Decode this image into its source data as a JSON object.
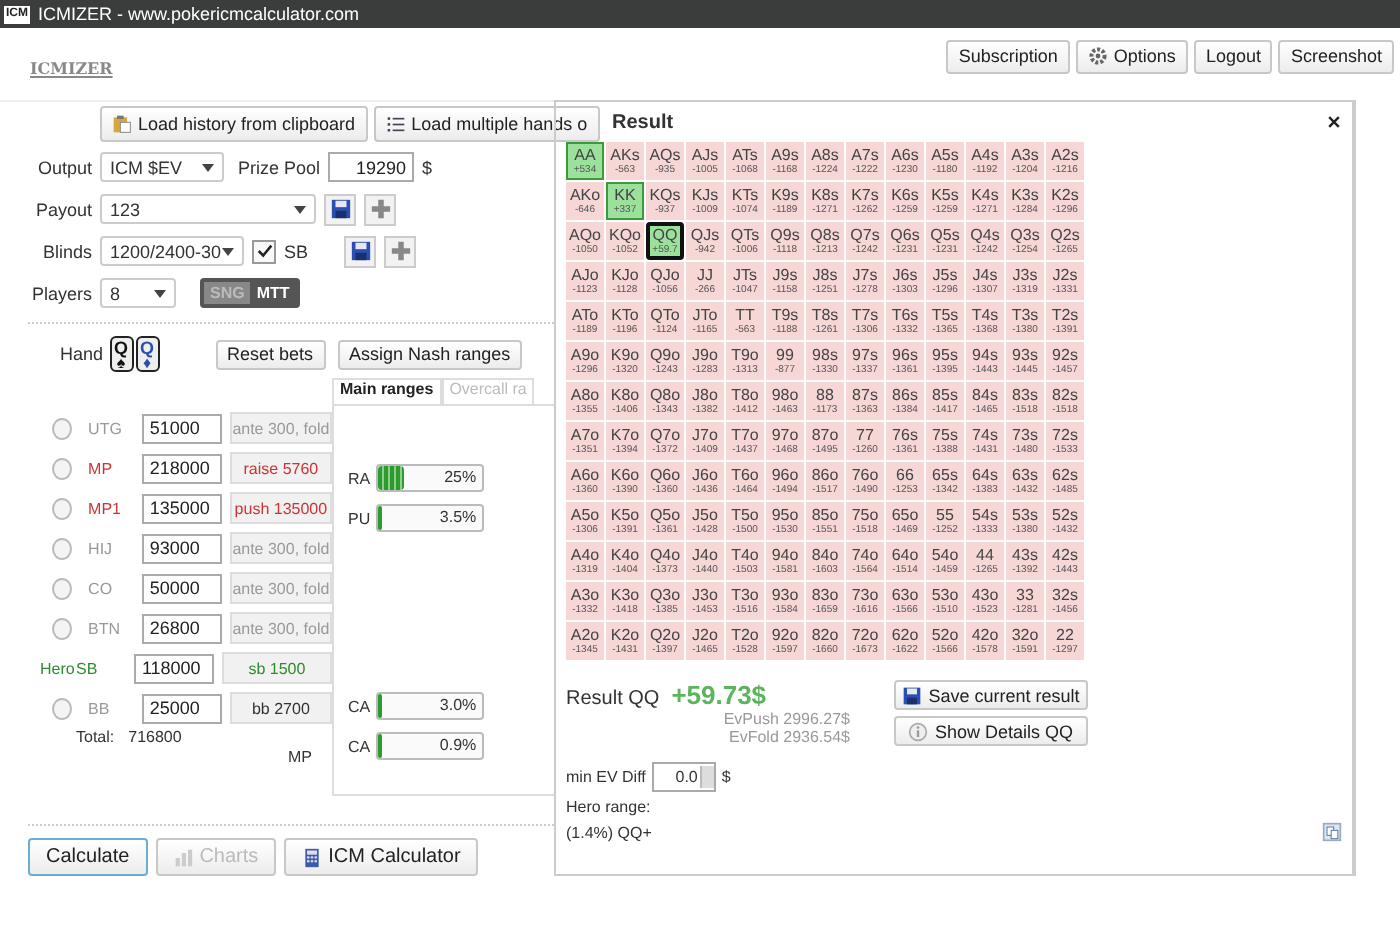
{
  "window": {
    "title": "ICMIZER - www.pokericmcalculator.com",
    "icon": "ICM"
  },
  "header": {
    "logo": "ICMIZER",
    "buttons": [
      "Subscription",
      "Options",
      "Logout",
      "Screenshot"
    ]
  },
  "load_buttons": [
    "Load history from clipboard",
    "Load multiple hands o"
  ],
  "settings": {
    "output": {
      "label": "Output",
      "value": "ICM $EV"
    },
    "prize_pool": {
      "label": "Prize Pool",
      "value": "19290",
      "unit": "$"
    },
    "payout": {
      "label": "Payout",
      "value": "123"
    },
    "blinds": {
      "label": "Blinds",
      "value": "1200/2400-30",
      "sb_label": "SB",
      "sb_checked": true
    },
    "players": {
      "label": "Players",
      "value": "8"
    },
    "mode": [
      {
        "label": "SNG",
        "selected": false
      },
      {
        "label": "MTT",
        "selected": true
      }
    ]
  },
  "hand": {
    "label": "Hand",
    "cards": [
      {
        "rank": "Q",
        "suit": "♠",
        "color": "#111111"
      },
      {
        "rank": "Q",
        "suit": "♦",
        "color": "#2a4fb0"
      }
    ]
  },
  "actions": [
    "Reset bets",
    "Assign Nash ranges"
  ],
  "positions": [
    {
      "name": "UTG",
      "stack": "51000",
      "action": "ante 300, fold",
      "kind": "fold",
      "selected": false
    },
    {
      "name": "MP",
      "stack": "218000",
      "action": "raise 5760",
      "kind": "raise",
      "selected": false
    },
    {
      "name": "MP1",
      "stack": "135000",
      "action": "push 135000",
      "kind": "raise",
      "selected": false
    },
    {
      "name": "HIJ",
      "stack": "93000",
      "action": "ante 300, fold",
      "kind": "fold",
      "selected": false
    },
    {
      "name": "CO",
      "stack": "50000",
      "action": "ante 300, fold",
      "kind": "fold",
      "selected": false
    },
    {
      "name": "BTN",
      "stack": "26800",
      "action": "ante 300, fold",
      "kind": "fold",
      "selected": false
    },
    {
      "name": "SB",
      "hero_label": "Hero",
      "stack": "118000",
      "action": "sb 1500",
      "kind": "hero"
    },
    {
      "name": "BB",
      "stack": "25000",
      "action": "bb 2700",
      "kind": "blind",
      "selected": false
    }
  ],
  "total": {
    "label": "Total:",
    "value": "716800"
  },
  "ranges": {
    "tabs": [
      {
        "label": "Main ranges",
        "selected": true
      },
      {
        "label": "Overcall ra",
        "selected": false
      }
    ],
    "upper_bars": [
      {
        "label": "RA",
        "reading": "25%",
        "level": 0.25
      },
      {
        "label": "PU",
        "reading": "3.5%",
        "level": 0.035
      }
    ],
    "lower_bars": [
      {
        "label": "CA",
        "reading": "3.0%",
        "level": 0.03
      },
      {
        "label": "CA",
        "reading": "0.9%",
        "level": 0.009
      }
    ],
    "caller": "MP"
  },
  "bottom_buttons": [
    {
      "label": "Calculate",
      "disabled": false
    },
    {
      "label": "Charts",
      "disabled": true
    },
    {
      "label": "ICM Calculator",
      "disabled": false
    }
  ],
  "result": {
    "title": "Result",
    "grid": [
      [
        {
          "h": "AA",
          "ev": "+534",
          "in_range": true,
          "selected": false
        },
        {
          "h": "AKs",
          "ev": "-563",
          "in_range": false,
          "selected": false
        },
        {
          "h": "AQs",
          "ev": "-935",
          "in_range": false,
          "selected": false
        },
        {
          "h": "AJs",
          "ev": "-1005",
          "in_range": false,
          "selected": false
        },
        {
          "h": "ATs",
          "ev": "-1068",
          "in_range": false,
          "selected": false
        },
        {
          "h": "A9s",
          "ev": "-1168",
          "in_range": false,
          "selected": false
        },
        {
          "h": "A8s",
          "ev": "-1224",
          "in_range": false,
          "selected": false
        },
        {
          "h": "A7s",
          "ev": "-1222",
          "in_range": false,
          "selected": false
        },
        {
          "h": "A6s",
          "ev": "-1230",
          "in_range": false,
          "selected": false
        },
        {
          "h": "A5s",
          "ev": "-1180",
          "in_range": false,
          "selected": false
        },
        {
          "h": "A4s",
          "ev": "-1192",
          "in_range": false,
          "selected": false
        },
        {
          "h": "A3s",
          "ev": "-1204",
          "in_range": false,
          "selected": false
        },
        {
          "h": "A2s",
          "ev": "-1216",
          "in_range": false,
          "selected": false
        }
      ],
      [
        {
          "h": "AKo",
          "ev": "-646",
          "in_range": false,
          "selected": false
        },
        {
          "h": "KK",
          "ev": "+337",
          "in_range": true,
          "selected": false
        },
        {
          "h": "KQs",
          "ev": "-937",
          "in_range": false,
          "selected": false
        },
        {
          "h": "KJs",
          "ev": "-1009",
          "in_range": false,
          "selected": false
        },
        {
          "h": "KTs",
          "ev": "-1074",
          "in_range": false,
          "selected": false
        },
        {
          "h": "K9s",
          "ev": "-1189",
          "in_range": false,
          "selected": false
        },
        {
          "h": "K8s",
          "ev": "-1271",
          "in_range": false,
          "selected": false
        },
        {
          "h": "K7s",
          "ev": "-1262",
          "in_range": false,
          "selected": false
        },
        {
          "h": "K6s",
          "ev": "-1259",
          "in_range": false,
          "selected": false
        },
        {
          "h": "K5s",
          "ev": "-1259",
          "in_range": false,
          "selected": false
        },
        {
          "h": "K4s",
          "ev": "-1271",
          "in_range": false,
          "selected": false
        },
        {
          "h": "K3s",
          "ev": "-1284",
          "in_range": false,
          "selected": false
        },
        {
          "h": "K2s",
          "ev": "-1296",
          "in_range": false,
          "selected": false
        }
      ],
      [
        {
          "h": "AQo",
          "ev": "-1050",
          "in_range": false,
          "selected": false
        },
        {
          "h": "KQo",
          "ev": "-1052",
          "in_range": false,
          "selected": false
        },
        {
          "h": "QQ",
          "ev": "+59.7",
          "in_range": true,
          "selected": true
        },
        {
          "h": "QJs",
          "ev": "-942",
          "in_range": false,
          "selected": false
        },
        {
          "h": "QTs",
          "ev": "-1006",
          "in_range": false,
          "selected": false
        },
        {
          "h": "Q9s",
          "ev": "-1118",
          "in_range": false,
          "selected": false
        },
        {
          "h": "Q8s",
          "ev": "-1213",
          "in_range": false,
          "selected": false
        },
        {
          "h": "Q7s",
          "ev": "-1242",
          "in_range": false,
          "selected": false
        },
        {
          "h": "Q6s",
          "ev": "-1231",
          "in_range": false,
          "selected": false
        },
        {
          "h": "Q5s",
          "ev": "-1231",
          "in_range": false,
          "selected": false
        },
        {
          "h": "Q4s",
          "ev": "-1242",
          "in_range": false,
          "selected": false
        },
        {
          "h": "Q3s",
          "ev": "-1254",
          "in_range": false,
          "selected": false
        },
        {
          "h": "Q2s",
          "ev": "-1265",
          "in_range": false,
          "selected": false
        }
      ],
      [
        {
          "h": "AJo",
          "ev": "-1123",
          "in_range": false,
          "selected": false
        },
        {
          "h": "KJo",
          "ev": "-1128",
          "in_range": false,
          "selected": false
        },
        {
          "h": "QJo",
          "ev": "-1056",
          "in_range": false,
          "selected": false
        },
        {
          "h": "JJ",
          "ev": "-266",
          "in_range": false,
          "selected": false
        },
        {
          "h": "JTs",
          "ev": "-1047",
          "in_range": false,
          "selected": false
        },
        {
          "h": "J9s",
          "ev": "-1158",
          "in_range": false,
          "selected": false
        },
        {
          "h": "J8s",
          "ev": "-1251",
          "in_range": false,
          "selected": false
        },
        {
          "h": "J7s",
          "ev": "-1278",
          "in_range": false,
          "selected": false
        },
        {
          "h": "J6s",
          "ev": "-1303",
          "in_range": false,
          "selected": false
        },
        {
          "h": "J5s",
          "ev": "-1296",
          "in_range": false,
          "selected": false
        },
        {
          "h": "J4s",
          "ev": "-1307",
          "in_range": false,
          "selected": false
        },
        {
          "h": "J3s",
          "ev": "-1319",
          "in_range": false,
          "selected": false
        },
        {
          "h": "J2s",
          "ev": "-1331",
          "in_range": false,
          "selected": false
        }
      ],
      [
        {
          "h": "ATo",
          "ev": "-1189",
          "in_range": false,
          "selected": false
        },
        {
          "h": "KTo",
          "ev": "-1196",
          "in_range": false,
          "selected": false
        },
        {
          "h": "QTo",
          "ev": "-1124",
          "in_range": false,
          "selected": false
        },
        {
          "h": "JTo",
          "ev": "-1165",
          "in_range": false,
          "selected": false
        },
        {
          "h": "TT",
          "ev": "-563",
          "in_range": false,
          "selected": false
        },
        {
          "h": "T9s",
          "ev": "-1188",
          "in_range": false,
          "selected": false
        },
        {
          "h": "T8s",
          "ev": "-1261",
          "in_range": false,
          "selected": false
        },
        {
          "h": "T7s",
          "ev": "-1306",
          "in_range": false,
          "selected": false
        },
        {
          "h": "T6s",
          "ev": "-1332",
          "in_range": false,
          "selected": false
        },
        {
          "h": "T5s",
          "ev": "-1365",
          "in_range": false,
          "selected": false
        },
        {
          "h": "T4s",
          "ev": "-1368",
          "in_range": false,
          "selected": false
        },
        {
          "h": "T3s",
          "ev": "-1380",
          "in_range": false,
          "selected": false
        },
        {
          "h": "T2s",
          "ev": "-1391",
          "in_range": false,
          "selected": false
        }
      ],
      [
        {
          "h": "A9o",
          "ev": "-1296",
          "in_range": false,
          "selected": false
        },
        {
          "h": "K9o",
          "ev": "-1320",
          "in_range": false,
          "selected": false
        },
        {
          "h": "Q9o",
          "ev": "-1243",
          "in_range": false,
          "selected": false
        },
        {
          "h": "J9o",
          "ev": "-1283",
          "in_range": false,
          "selected": false
        },
        {
          "h": "T9o",
          "ev": "-1313",
          "in_range": false,
          "selected": false
        },
        {
          "h": "99",
          "ev": "-877",
          "in_range": false,
          "selected": false
        },
        {
          "h": "98s",
          "ev": "-1330",
          "in_range": false,
          "selected": false
        },
        {
          "h": "97s",
          "ev": "-1337",
          "in_range": false,
          "selected": false
        },
        {
          "h": "96s",
          "ev": "-1361",
          "in_range": false,
          "selected": false
        },
        {
          "h": "95s",
          "ev": "-1395",
          "in_range": false,
          "selected": false
        },
        {
          "h": "94s",
          "ev": "-1443",
          "in_range": false,
          "selected": false
        },
        {
          "h": "93s",
          "ev": "-1445",
          "in_range": false,
          "selected": false
        },
        {
          "h": "92s",
          "ev": "-1457",
          "in_range": false,
          "selected": false
        }
      ],
      [
        {
          "h": "A8o",
          "ev": "-1355",
          "in_range": false,
          "selected": false
        },
        {
          "h": "K8o",
          "ev": "-1406",
          "in_range": false,
          "selected": false
        },
        {
          "h": "Q8o",
          "ev": "-1343",
          "in_range": false,
          "selected": false
        },
        {
          "h": "J8o",
          "ev": "-1382",
          "in_range": false,
          "selected": false
        },
        {
          "h": "T8o",
          "ev": "-1412",
          "in_range": false,
          "selected": false
        },
        {
          "h": "98o",
          "ev": "-1463",
          "in_range": false,
          "selected": false
        },
        {
          "h": "88",
          "ev": "-1173",
          "in_range": false,
          "selected": false
        },
        {
          "h": "87s",
          "ev": "-1363",
          "in_range": false,
          "selected": false
        },
        {
          "h": "86s",
          "ev": "-1384",
          "in_range": false,
          "selected": false
        },
        {
          "h": "85s",
          "ev": "-1417",
          "in_range": false,
          "selected": false
        },
        {
          "h": "84s",
          "ev": "-1465",
          "in_range": false,
          "selected": false
        },
        {
          "h": "83s",
          "ev": "-1518",
          "in_range": false,
          "selected": false
        },
        {
          "h": "82s",
          "ev": "-1518",
          "in_range": false,
          "selected": false
        }
      ],
      [
        {
          "h": "A7o",
          "ev": "-1351",
          "in_range": false,
          "selected": false
        },
        {
          "h": "K7o",
          "ev": "-1394",
          "in_range": false,
          "selected": false
        },
        {
          "h": "Q7o",
          "ev": "-1372",
          "in_range": false,
          "selected": false
        },
        {
          "h": "J7o",
          "ev": "-1409",
          "in_range": false,
          "selected": false
        },
        {
          "h": "T7o",
          "ev": "-1437",
          "in_range": false,
          "selected": false
        },
        {
          "h": "97o",
          "ev": "-1468",
          "in_range": false,
          "selected": false
        },
        {
          "h": "87o",
          "ev": "-1495",
          "in_range": false,
          "selected": false
        },
        {
          "h": "77",
          "ev": "-1260",
          "in_range": false,
          "selected": false
        },
        {
          "h": "76s",
          "ev": "-1361",
          "in_range": false,
          "selected": false
        },
        {
          "h": "75s",
          "ev": "-1388",
          "in_range": false,
          "selected": false
        },
        {
          "h": "74s",
          "ev": "-1431",
          "in_range": false,
          "selected": false
        },
        {
          "h": "73s",
          "ev": "-1480",
          "in_range": false,
          "selected": false
        },
        {
          "h": "72s",
          "ev": "-1533",
          "in_range": false,
          "selected": false
        }
      ],
      [
        {
          "h": "A6o",
          "ev": "-1360",
          "in_range": false,
          "selected": false
        },
        {
          "h": "K6o",
          "ev": "-1390",
          "in_range": false,
          "selected": false
        },
        {
          "h": "Q6o",
          "ev": "-1360",
          "in_range": false,
          "selected": false
        },
        {
          "h": "J6o",
          "ev": "-1436",
          "in_range": false,
          "selected": false
        },
        {
          "h": "T6o",
          "ev": "-1464",
          "in_range": false,
          "selected": false
        },
        {
          "h": "96o",
          "ev": "-1494",
          "in_range": false,
          "selected": false
        },
        {
          "h": "86o",
          "ev": "-1517",
          "in_range": false,
          "selected": false
        },
        {
          "h": "76o",
          "ev": "-1490",
          "in_range": false,
          "selected": false
        },
        {
          "h": "66",
          "ev": "-1253",
          "in_range": false,
          "selected": false
        },
        {
          "h": "65s",
          "ev": "-1342",
          "in_range": false,
          "selected": false
        },
        {
          "h": "64s",
          "ev": "-1383",
          "in_range": false,
          "selected": false
        },
        {
          "h": "63s",
          "ev": "-1432",
          "in_range": false,
          "selected": false
        },
        {
          "h": "62s",
          "ev": "-1485",
          "in_range": false,
          "selected": false
        }
      ],
      [
        {
          "h": "A5o",
          "ev": "-1306",
          "in_range": false,
          "selected": false
        },
        {
          "h": "K5o",
          "ev": "-1391",
          "in_range": false,
          "selected": false
        },
        {
          "h": "Q5o",
          "ev": "-1361",
          "in_range": false,
          "selected": false
        },
        {
          "h": "J5o",
          "ev": "-1428",
          "in_range": false,
          "selected": false
        },
        {
          "h": "T5o",
          "ev": "-1500",
          "in_range": false,
          "selected": false
        },
        {
          "h": "95o",
          "ev": "-1530",
          "in_range": false,
          "selected": false
        },
        {
          "h": "85o",
          "ev": "-1551",
          "in_range": false,
          "selected": false
        },
        {
          "h": "75o",
          "ev": "-1518",
          "in_range": false,
          "selected": false
        },
        {
          "h": "65o",
          "ev": "-1469",
          "in_range": false,
          "selected": false
        },
        {
          "h": "55",
          "ev": "-1252",
          "in_range": false,
          "selected": false
        },
        {
          "h": "54s",
          "ev": "-1333",
          "in_range": false,
          "selected": false
        },
        {
          "h": "53s",
          "ev": "-1380",
          "in_range": false,
          "selected": false
        },
        {
          "h": "52s",
          "ev": "-1432",
          "in_range": false,
          "selected": false
        }
      ],
      [
        {
          "h": "A4o",
          "ev": "-1319",
          "in_range": false,
          "selected": false
        },
        {
          "h": "K4o",
          "ev": "-1404",
          "in_range": false,
          "selected": false
        },
        {
          "h": "Q4o",
          "ev": "-1373",
          "in_range": false,
          "selected": false
        },
        {
          "h": "J4o",
          "ev": "-1440",
          "in_range": false,
          "selected": false
        },
        {
          "h": "T4o",
          "ev": "-1503",
          "in_range": false,
          "selected": false
        },
        {
          "h": "94o",
          "ev": "-1581",
          "in_range": false,
          "selected": false
        },
        {
          "h": "84o",
          "ev": "-1603",
          "in_range": false,
          "selected": false
        },
        {
          "h": "74o",
          "ev": "-1564",
          "in_range": false,
          "selected": false
        },
        {
          "h": "64o",
          "ev": "-1514",
          "in_range": false,
          "selected": false
        },
        {
          "h": "54o",
          "ev": "-1459",
          "in_range": false,
          "selected": false
        },
        {
          "h": "44",
          "ev": "-1265",
          "in_range": false,
          "selected": false
        },
        {
          "h": "43s",
          "ev": "-1392",
          "in_range": false,
          "selected": false
        },
        {
          "h": "42s",
          "ev": "-1443",
          "in_range": false,
          "selected": false
        }
      ],
      [
        {
          "h": "A3o",
          "ev": "-1332",
          "in_range": false,
          "selected": false
        },
        {
          "h": "K3o",
          "ev": "-1418",
          "in_range": false,
          "selected": false
        },
        {
          "h": "Q3o",
          "ev": "-1385",
          "in_range": false,
          "selected": false
        },
        {
          "h": "J3o",
          "ev": "-1453",
          "in_range": false,
          "selected": false
        },
        {
          "h": "T3o",
          "ev": "-1516",
          "in_range": false,
          "selected": false
        },
        {
          "h": "93o",
          "ev": "-1584",
          "in_range": false,
          "selected": false
        },
        {
          "h": "83o",
          "ev": "-1659",
          "in_range": false,
          "selected": false
        },
        {
          "h": "73o",
          "ev": "-1616",
          "in_range": false,
          "selected": false
        },
        {
          "h": "63o",
          "ev": "-1566",
          "in_range": false,
          "selected": false
        },
        {
          "h": "53o",
          "ev": "-1510",
          "in_range": false,
          "selected": false
        },
        {
          "h": "43o",
          "ev": "-1523",
          "in_range": false,
          "selected": false
        },
        {
          "h": "33",
          "ev": "-1281",
          "in_range": false,
          "selected": false
        },
        {
          "h": "32s",
          "ev": "-1456",
          "in_range": false,
          "selected": false
        }
      ],
      [
        {
          "h": "A2o",
          "ev": "-1345",
          "in_range": false,
          "selected": false
        },
        {
          "h": "K2o",
          "ev": "-1431",
          "in_range": false,
          "selected": false
        },
        {
          "h": "Q2o",
          "ev": "-1397",
          "in_range": false,
          "selected": false
        },
        {
          "h": "J2o",
          "ev": "-1465",
          "in_range": false,
          "selected": false
        },
        {
          "h": "T2o",
          "ev": "-1528",
          "in_range": false,
          "selected": false
        },
        {
          "h": "92o",
          "ev": "-1597",
          "in_range": false,
          "selected": false
        },
        {
          "h": "82o",
          "ev": "-1660",
          "in_range": false,
          "selected": false
        },
        {
          "h": "72o",
          "ev": "-1673",
          "in_range": false,
          "selected": false
        },
        {
          "h": "62o",
          "ev": "-1622",
          "in_range": false,
          "selected": false
        },
        {
          "h": "52o",
          "ev": "-1566",
          "in_range": false,
          "selected": false
        },
        {
          "h": "42o",
          "ev": "-1578",
          "in_range": false,
          "selected": false
        },
        {
          "h": "32o",
          "ev": "-1591",
          "in_range": false,
          "selected": false
        },
        {
          "h": "22",
          "ev": "-1297",
          "in_range": false,
          "selected": false
        }
      ]
    ],
    "summary": {
      "label": "Result QQ",
      "value": "+59.73$",
      "ev_push": "EvPush 2996.27$",
      "ev_fold": "EvFold 2936.54$"
    },
    "buttons": [
      "Save current result",
      "Show Details QQ"
    ],
    "min_ev": {
      "label": "min EV Diff",
      "value": "0.0",
      "unit": "$"
    },
    "hero_range": {
      "label": "Hero range:",
      "value": "(1.4%) QQ+"
    }
  }
}
